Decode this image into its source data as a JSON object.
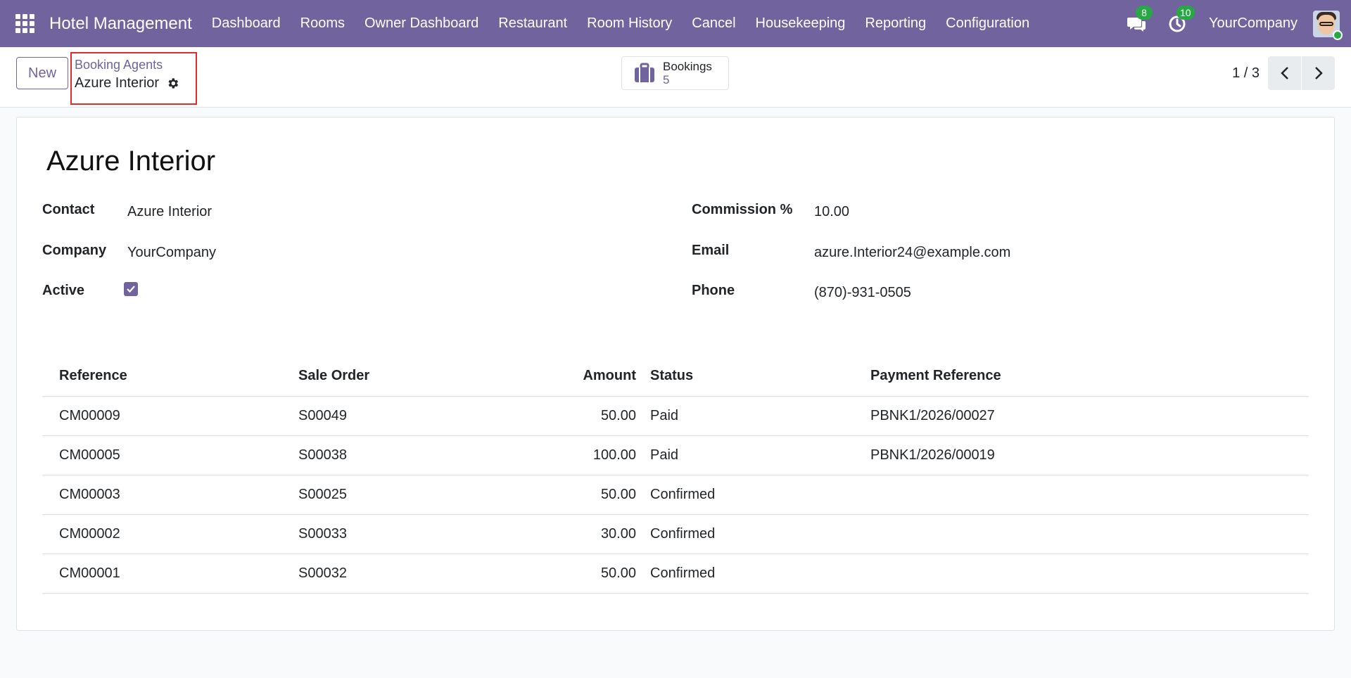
{
  "navbar": {
    "app_name": "Hotel Management",
    "menu": [
      "Dashboard",
      "Rooms",
      "Owner Dashboard",
      "Restaurant",
      "Room History",
      "Cancel",
      "Housekeeping",
      "Reporting",
      "Configuration"
    ],
    "messages_count": "8",
    "activities_count": "10",
    "company": "YourCompany"
  },
  "control_panel": {
    "new_label": "New",
    "breadcrumb_parent": "Booking Agents",
    "breadcrumb_current": "Azure Interior",
    "smart_button": {
      "label": "Bookings",
      "count": "5"
    },
    "pager": "1 / 3"
  },
  "record": {
    "name": "Azure Interior",
    "contact_label": "Contact",
    "contact": "Azure Interior",
    "company_label": "Company",
    "company": "YourCompany",
    "active_label": "Active",
    "active": true,
    "commission_label": "Commission %",
    "commission": "10.00",
    "email_label": "Email",
    "email": "azure.Interior24@example.com",
    "phone_label": "Phone",
    "phone": "(870)-931-0505"
  },
  "lines": {
    "headers": [
      "Reference",
      "Sale Order",
      "Amount",
      "Status",
      "Payment Reference"
    ],
    "rows": [
      [
        "CM00009",
        "S00049",
        "50.00",
        "Paid",
        "PBNK1/2026/00027"
      ],
      [
        "CM00005",
        "S00038",
        "100.00",
        "Paid",
        "PBNK1/2026/00019"
      ],
      [
        "CM00003",
        "S00025",
        "50.00",
        "Confirmed",
        ""
      ],
      [
        "CM00002",
        "S00033",
        "30.00",
        "Confirmed",
        ""
      ],
      [
        "CM00001",
        "S00032",
        "50.00",
        "Confirmed",
        ""
      ]
    ]
  },
  "colors": {
    "brand": "#71639e",
    "badge": "#28a745",
    "highlight": "#e02b2b"
  }
}
